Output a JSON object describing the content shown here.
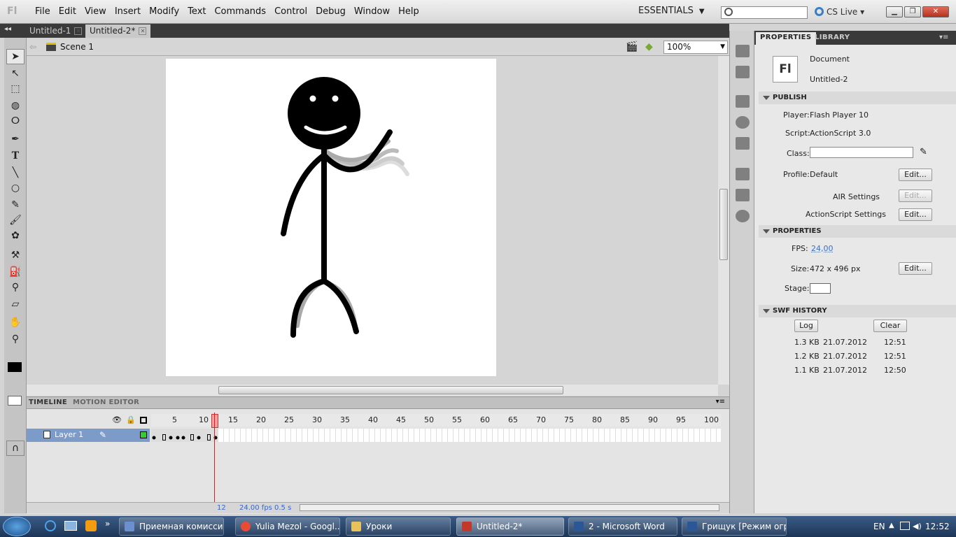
{
  "app": {
    "logo": "Fl",
    "workspace": "ESSENTIALS",
    "cs_live": "CS Live"
  },
  "menu": [
    "File",
    "Edit",
    "View",
    "Insert",
    "Modify",
    "Text",
    "Commands",
    "Control",
    "Debug",
    "Window",
    "Help"
  ],
  "doc_tabs": [
    "Untitled-1",
    "Untitled-2*"
  ],
  "scene": {
    "label": "Scene 1",
    "zoom": "100%"
  },
  "timeline": {
    "tabs": [
      "TIMELINE",
      "MOTION EDITOR"
    ],
    "layer": "Layer 1",
    "ruler": [
      "5",
      "10",
      "15",
      "20",
      "25",
      "30",
      "35",
      "40",
      "45",
      "50",
      "55",
      "60",
      "65",
      "70",
      "75",
      "80",
      "85",
      "90",
      "95",
      "100"
    ],
    "current_frame": "12",
    "fps": "24.00 fps",
    "time": "0.5 s"
  },
  "panel": {
    "tabs": [
      "PROPERTIES",
      "LIBRARY"
    ],
    "doc_type": "Document",
    "doc_name": "Untitled-2",
    "doc_icon": "Fl",
    "publish_title": "PUBLISH",
    "player_label": "Player:",
    "player": "Flash Player 10",
    "script_label": "Script:",
    "script": "ActionScript 3.0",
    "class_label": "Class:",
    "profile_label": "Profile:",
    "profile": "Default",
    "edit": "Edit...",
    "air_settings": "AIR Settings",
    "as_settings": "ActionScript Settings",
    "props_title": "PROPERTIES",
    "fps_label": "FPS:",
    "fps": "24,00",
    "size_label": "Size:",
    "size": "472 x 496 px",
    "stage_label": "Stage:",
    "swf_title": "SWF HISTORY",
    "log": "Log",
    "clear": "Clear",
    "history": [
      {
        "size": "1.3 KB",
        "date": "21.07.2012",
        "time": "12:51"
      },
      {
        "size": "1.2 KB",
        "date": "21.07.2012",
        "time": "12:51"
      },
      {
        "size": "1.1 KB",
        "date": "21.07.2012",
        "time": "12:50"
      }
    ]
  },
  "taskbar": {
    "items": [
      "Приемная комиссия",
      "Yulia Mezol - Googl...",
      "Уроки",
      "Untitled-2*",
      "2 - Microsoft Word",
      "Грищук [Режим огр..."
    ],
    "lang": "EN",
    "clock": "12:52"
  }
}
